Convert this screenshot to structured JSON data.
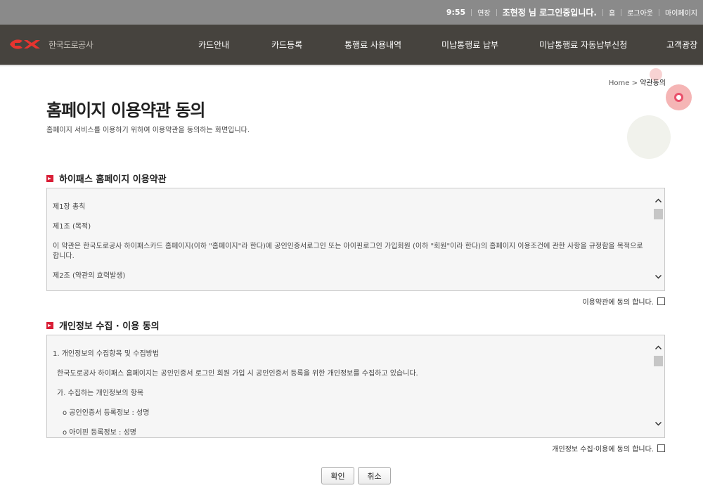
{
  "topbar": {
    "time": "9:55",
    "extend": "연장",
    "user_status": "조현정 님 로그인중입니다.",
    "home": "홈",
    "logout": "로그아웃",
    "mypage": "마이페이지"
  },
  "gnb": {
    "logo_text": "한국도로공사",
    "menu": [
      "카드안내",
      "카드등록",
      "통행료 사용내역",
      "미납통행료 납부",
      "미납통행료 자동납부신청",
      "고객광장"
    ]
  },
  "breadcrumb": {
    "home": "Home",
    "separator": ">",
    "current": "약관동의"
  },
  "page": {
    "title": "홈페이지 이용약관 동의",
    "description": "홈페이지 서비스를 이용하기 위하여 이용약관을 동의하는 화면입니다."
  },
  "terms": {
    "title": "하이패스 홈페이지 이용약관",
    "lines": [
      "제1장 총칙",
      "제1조 (목적)",
      "이 약관은 한국도로공사 하이패스카드 홈페이지(이하 \"홈페이지\"라 한다)에 공인인증서로그인 또는 아이핀로그인 가입회원 (이하 \"회원\"이라 한다)의 홈페이지 이용조건에 관한 사항을 규정함을 목적으로 합니다.",
      "제2조 (약관의 효력발생)"
    ],
    "agree_label": "이용약관에 동의 합니다."
  },
  "privacy": {
    "title": "개인정보 수집 · 이용 동의",
    "lines": [
      "1. 개인정보의 수집항목 및 수집방법",
      "한국도로공사 하이패스 홈페이지는 공인인증서 로그인 회원 가입 시 공인인증서 등록을 위한 개인정보를 수집하고 있습니다.",
      "가. 수집하는 개인정보의 항목",
      "o 공인인증서 등록정보 : 성명",
      "o 아이핀 등록정보 : 성명"
    ],
    "agree_label": "개인정보 수집·이용에 동의 합니다."
  },
  "buttons": {
    "confirm": "확인",
    "cancel": "취소"
  },
  "colors": {
    "topbar": "#8a8a8a",
    "gnb": "#46433e",
    "accent": "#d91e36"
  }
}
